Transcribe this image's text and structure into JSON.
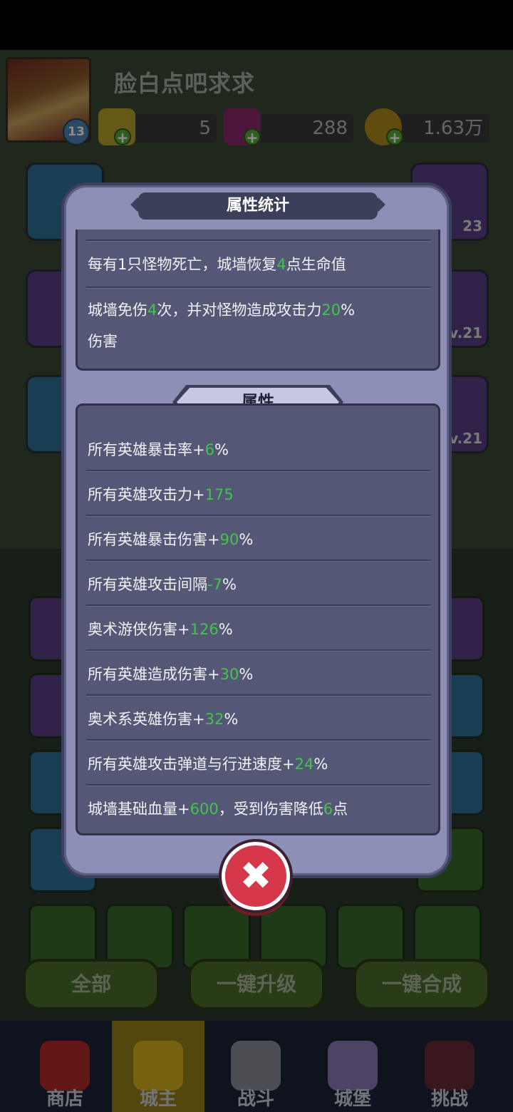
{
  "player": {
    "name": "脸白点吧求求",
    "level": "13"
  },
  "resources": [
    {
      "name": "gold-bar",
      "value": "5",
      "icon": "gold-bar-icon"
    },
    {
      "name": "gem",
      "value": "288",
      "icon": "purple-gem-icon"
    },
    {
      "name": "coin",
      "value": "1.63万",
      "icon": "coin-icon"
    }
  ],
  "side_cards": {
    "right_values": [
      "23",
      "v.21",
      "v.21"
    ]
  },
  "dialog": {
    "title": "属性统计",
    "effects": [
      {
        "pre": "每有1只怪物死亡，城墙恢复",
        "num": "4",
        "post": "点生命值"
      },
      {
        "pre": "城墙免伤",
        "num": "4",
        "post": "次，并对怪物造成攻击力",
        "num2": "20",
        "post2": "%",
        "line2": "伤害"
      }
    ],
    "section_title": "属性",
    "attributes": [
      {
        "pre": "所有英雄暴击率+",
        "num": "6",
        "post": "%"
      },
      {
        "pre": "所有英雄攻击力+",
        "num": "175",
        "post": ""
      },
      {
        "pre": "所有英雄暴击伤害+",
        "num": "90",
        "post": "%"
      },
      {
        "pre": "所有英雄攻击间隔",
        "num": "-7",
        "post": "%"
      },
      {
        "pre": "奥术游侠伤害+",
        "num": "126",
        "post": "%"
      },
      {
        "pre": "所有英雄造成伤害+",
        "num": "30",
        "post": "%"
      },
      {
        "pre": "奥术系英雄伤害+",
        "num": "32",
        "post": "%"
      },
      {
        "pre": "所有英雄攻击弹道与行进速度+",
        "num": "24",
        "post": "%"
      },
      {
        "pre": "城墙基础血量+",
        "num": "600",
        "post": "，受到伤害降低",
        "num2": "6",
        "post2": "点"
      }
    ],
    "close_icon": "close-x-icon"
  },
  "bottom_buttons": {
    "all": "全部",
    "upgrade": "一键升级",
    "merge": "一键合成"
  },
  "tabs": [
    {
      "label": "商店",
      "icon": "shop-icon"
    },
    {
      "label": "城主",
      "icon": "crown-icon"
    },
    {
      "label": "战斗",
      "icon": "crossed-swords-icon"
    },
    {
      "label": "城堡",
      "icon": "castle-icon"
    },
    {
      "label": "挑战",
      "icon": "demon-icon"
    }
  ],
  "colors": {
    "highlight_number": "#44c24a",
    "dialog_bg": "#8d8fb6",
    "panel_bg": "#555777",
    "close_button": "#d6364a"
  }
}
